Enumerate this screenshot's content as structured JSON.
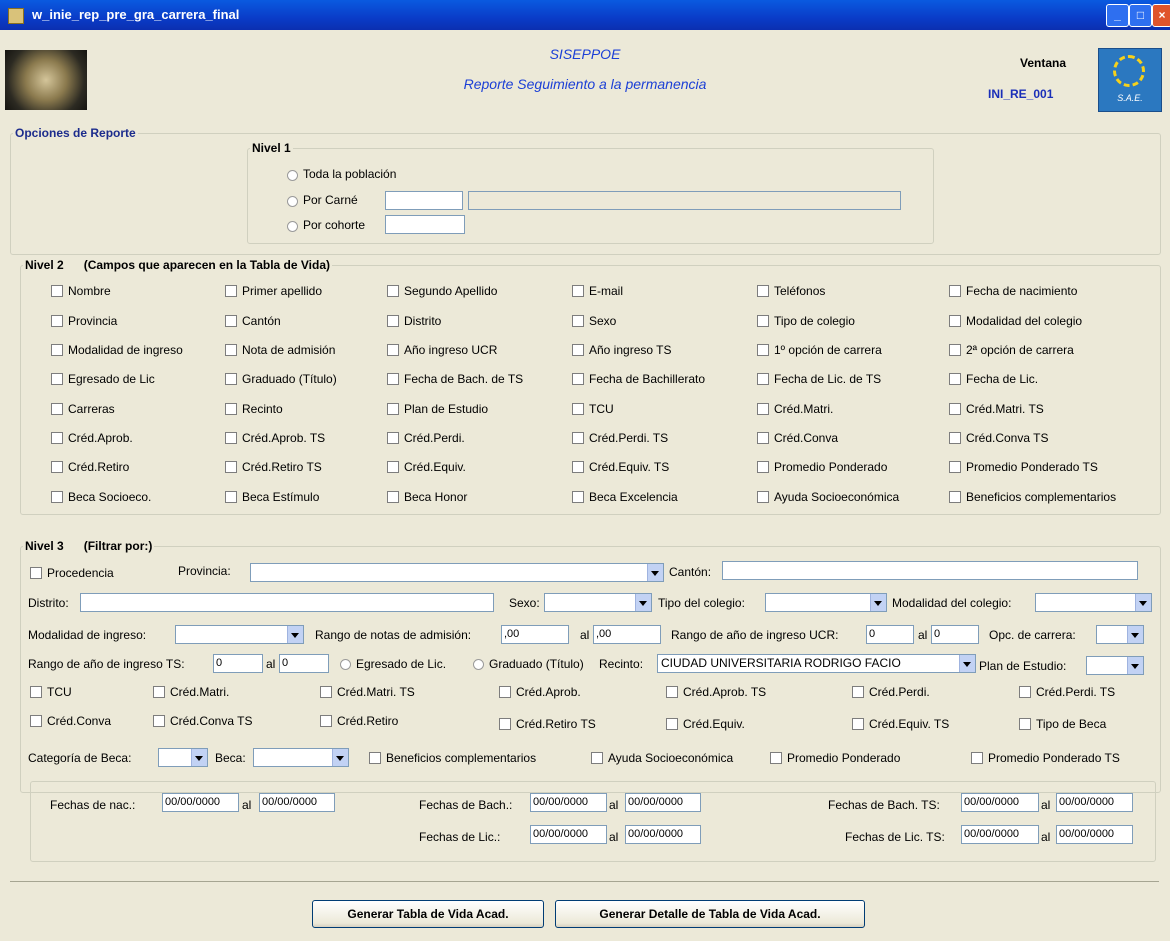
{
  "window": {
    "title": "w_inie_rep_pre_gra_carrera_final"
  },
  "header": {
    "app_name": "SISEPPOE",
    "report_name": "Reporte Seguimiento a la permanencia",
    "window_label": "Ventana",
    "window_code": "INI_RE_001",
    "logo_text": "S.A.E."
  },
  "opciones": {
    "legend": "Opciones de Reporte"
  },
  "nivel1": {
    "legend": "Nivel 1",
    "options": [
      "Toda la población",
      "Por Carné",
      "Por cohorte"
    ],
    "carne_value": "",
    "carne_name": "",
    "cohorte_value": ""
  },
  "nivel2": {
    "legend": "Nivel 2",
    "subtitle": "(Campos que aparecen en la Tabla de Vida)",
    "rows": [
      [
        "Nombre",
        "Primer apellido",
        "Segundo Apellido",
        "E-mail",
        "Teléfonos",
        "Fecha de nacimiento"
      ],
      [
        "Provincia",
        "Cantón",
        "Distrito",
        "Sexo",
        "Tipo de colegio",
        "Modalidad del colegio"
      ],
      [
        "Modalidad de ingreso",
        "Nota de admisión",
        "Año ingreso UCR",
        "Año ingreso TS",
        "1º opción de carrera",
        "2ª opción de carrera"
      ],
      [
        "Egresado de Lic",
        "Graduado (Título)",
        "Fecha de Bach. de TS",
        "Fecha de Bachillerato",
        "Fecha de Lic. de TS",
        "Fecha de Lic."
      ],
      [
        "Carreras",
        "Recinto",
        "Plan de Estudio",
        "TCU",
        "Créd.Matri.",
        "Créd.Matri. TS"
      ],
      [
        "Créd.Aprob.",
        "Créd.Aprob. TS",
        "Créd.Perdi.",
        "Créd.Perdi. TS",
        "Créd.Conva",
        "Créd.Conva TS"
      ],
      [
        "Créd.Retiro",
        "Créd.Retiro TS",
        "Créd.Equiv.",
        "Créd.Equiv. TS",
        "Promedio Ponderado",
        "Promedio Ponderado TS"
      ],
      [
        "Beca Socioeco.",
        "Beca Estímulo",
        "Beca Honor",
        "Beca Excelencia",
        "Ayuda Socioeconómica",
        "Beneficios complementarios"
      ]
    ]
  },
  "nivel3": {
    "legend": "Nivel 3",
    "subtitle": "(Filtrar por:)",
    "procedencia": "Procedencia",
    "provincia_label": "Provincia:",
    "provincia_value": "",
    "canton_label": "Cantón:",
    "canton_value": "",
    "distrito_label": "Distrito:",
    "distrito_value": "",
    "sexo_label": "Sexo:",
    "sexo_value": "",
    "tipo_colegio_label": "Tipo del colegio:",
    "tipo_colegio_value": "",
    "modalidad_colegio_label": "Modalidad del colegio:",
    "modalidad_colegio_value": "",
    "modalidad_ingreso_label": "Modalidad de ingreso:",
    "modalidad_ingreso_value": "",
    "rango_notas_label": "Rango de notas de admisión:",
    "nota_desde": ",00",
    "al": "al",
    "nota_hasta": ",00",
    "rango_ucr_label": "Rango de año de ingreso UCR:",
    "ucr_desde": "0",
    "ucr_hasta": "0",
    "opc_carrera_label": "Opc. de carrera:",
    "opc_carrera_value": "",
    "rango_ts_label": "Rango de año de ingreso TS:",
    "ts_desde": "0",
    "ts_hasta": "0",
    "egresado_label": "Egresado de Lic.",
    "graduado_label": "Graduado (Título)",
    "recinto_label": "Recinto:",
    "recinto_value": "CIUDAD UNIVERSITARIA RODRIGO FACIO",
    "plan_label": "Plan de Estudio:",
    "plan_value": "",
    "check_row1": [
      "TCU",
      "Créd.Matri.",
      "Créd.Matri. TS",
      "Créd.Aprob.",
      "Créd.Aprob. TS",
      "Créd.Perdi.",
      "Créd.Perdi. TS"
    ],
    "check_row2": [
      "Créd.Conva",
      "Créd.Conva TS",
      "Créd.Retiro",
      "Créd.Retiro TS",
      "Créd.Equiv.",
      "Créd.Equiv. TS",
      "Tipo de Beca"
    ],
    "categoria_label": "Categoría de Beca:",
    "categoria_value": "",
    "beca_label": "Beca:",
    "beca_value": "",
    "check_row3": [
      "Beneficios complementarios",
      "Ayuda Socioeconómica",
      "Promedio Ponderado",
      "Promedio Ponderado TS"
    ],
    "fechas_nac_label": "Fechas de nac.:",
    "fechas_bach_label": "Fechas de Bach.:",
    "fechas_bach_ts_label": "Fechas de Bach. TS:",
    "fechas_lic_label": "Fechas de Lic.:",
    "fechas_lic_ts_label": "Fechas de Lic. TS:",
    "date_placeholder": "00/00/0000"
  },
  "buttons": {
    "generar_tabla": "Generar Tabla de Vida Acad.",
    "generar_detalle": "Generar Detalle de Tabla de Vida Acad."
  }
}
